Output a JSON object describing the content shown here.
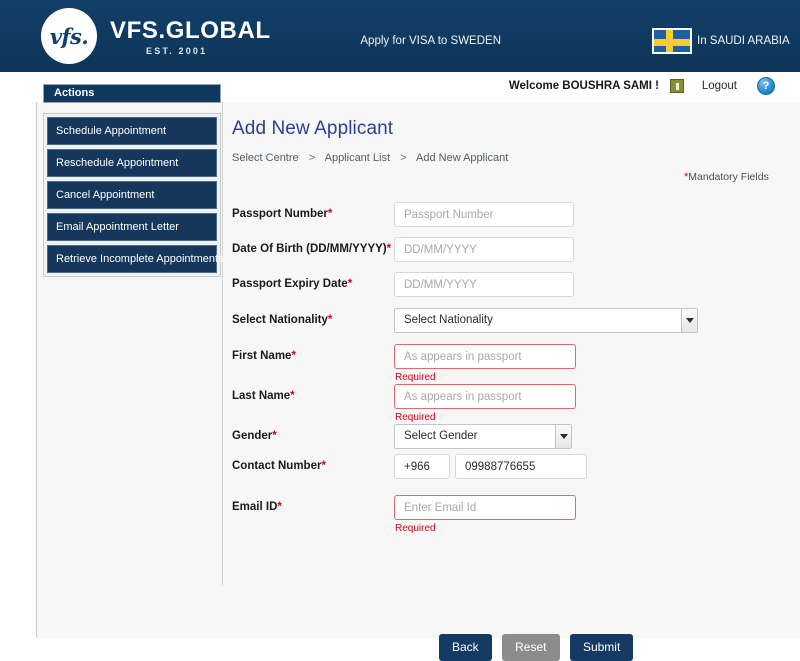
{
  "header": {
    "brand_name": "VFS.GLOBAL",
    "brand_est": "EST. 2001",
    "logo_text": "vfs.",
    "apply_text": "Apply for VISA to SWEDEN",
    "in_place_text": "In SAUDI ARABIA",
    "flag_name": "sweden-flag"
  },
  "topbar": {
    "welcome": "Welcome BOUSHRA SAMI !",
    "logout_label": "Logout",
    "help_glyph": "?"
  },
  "sidebar": {
    "section_title": "Actions",
    "items": [
      {
        "label": "Schedule Appointment"
      },
      {
        "label": "Reschedule Appointment"
      },
      {
        "label": "Cancel Appointment"
      },
      {
        "label": "Email Appointment Letter"
      },
      {
        "label": "Retrieve Incomplete Appointments"
      }
    ]
  },
  "main": {
    "page_title": "Add New Applicant",
    "breadcrumb": {
      "item1": "Select Centre",
      "sep1": ">",
      "item2": "Applicant List",
      "sep2": ">",
      "item3": "Add New Applicant"
    },
    "mandatory_note": "Mandatory Fields",
    "asterisk": "*"
  },
  "form": {
    "passport_number": {
      "label": "Passport Number",
      "placeholder": "Passport Number",
      "value": "",
      "required": "*"
    },
    "date_of_birth": {
      "label": "Date Of Birth (DD/MM/YYYY)",
      "placeholder": "DD/MM/YYYY",
      "value": "",
      "required": "*"
    },
    "passport_expiry": {
      "label": "Passport Expiry Date",
      "placeholder": "DD/MM/YYYY",
      "value": "",
      "required": "*"
    },
    "nationality": {
      "label": "Select Nationality",
      "selected": "Select Nationality",
      "required": "*"
    },
    "first_name": {
      "label": "First Name",
      "placeholder": "As appears in passport",
      "value": "",
      "required": "*",
      "error": "Required"
    },
    "last_name": {
      "label": "Last Name",
      "placeholder": "As appears in passport",
      "value": "",
      "required": "*",
      "error": "Required"
    },
    "gender": {
      "label": "Gender",
      "selected": "Select Gender",
      "required": "*"
    },
    "contact_number": {
      "label": "Contact Number",
      "required": "*",
      "country_code": "+966",
      "number": "09988776655"
    },
    "email": {
      "label": "Email ID",
      "placeholder": "Enter Email Id",
      "value": "",
      "required": "*",
      "error": "Required"
    }
  },
  "buttons": {
    "back": "Back",
    "reset": "Reset",
    "submit": "Submit"
  },
  "colors": {
    "brand_navy": "#0e3a63",
    "title_blue": "#2e3f8f",
    "error_red": "#d0021b",
    "reset_gray": "#8c8c8c"
  }
}
